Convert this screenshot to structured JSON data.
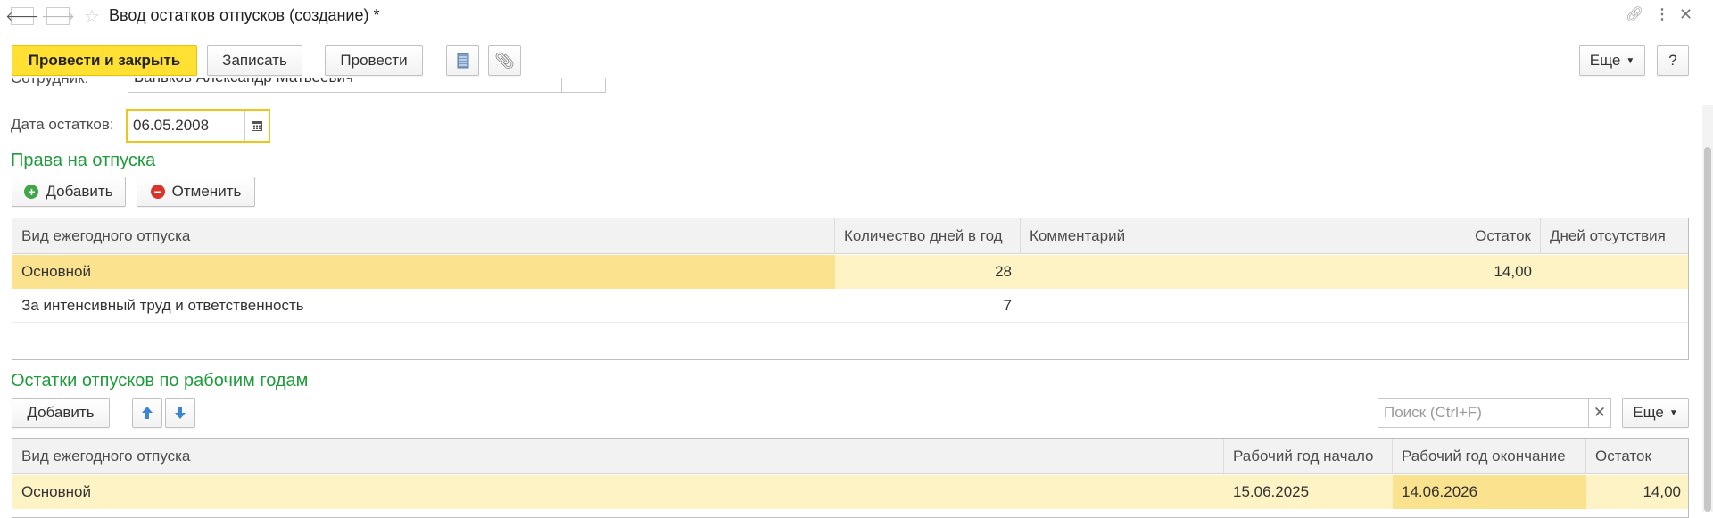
{
  "window": {
    "title": "Ввод остатков отпусков (создание) *",
    "back_icon": "arrow-left-icon",
    "forward_icon": "arrow-right-icon",
    "star_icon": "star-icon",
    "link_icon": "link-icon",
    "more_icon": "vertical-dots-icon",
    "close_icon": "close-icon"
  },
  "toolbar": {
    "post_and_close": "Провести и закрыть",
    "save": "Записать",
    "post": "Провести",
    "more": "Еще",
    "help": "?"
  },
  "form": {
    "employee_label": "Сотрудник:",
    "employee_value": "Баньков Александр Матвеевич",
    "date_label": "Дата остатков:",
    "date_value": "06.05.2008"
  },
  "rights": {
    "title": "Права на отпуска",
    "add": "Добавить",
    "cancel": "Отменить",
    "columns": [
      "Вид ежегодного отпуска",
      "Количество дней в год",
      "Комментарий",
      "Остаток",
      "Дней отсутствия"
    ],
    "rows": [
      {
        "type": "Основной",
        "days": "28",
        "comment": "",
        "remainder": "14,00",
        "absence": ""
      },
      {
        "type": "За интенсивный труд и ответственность",
        "days": "7",
        "comment": "",
        "remainder": "",
        "absence": ""
      }
    ]
  },
  "balances": {
    "title": "Остатки отпусков по рабочим годам",
    "add": "Добавить",
    "search_placeholder": "Поиск (Ctrl+F)",
    "more": "Еще",
    "columns": [
      "Вид ежегодного отпуска",
      "Рабочий год начало",
      "Рабочий год окончание",
      "Остаток"
    ],
    "rows": [
      {
        "type": "Основной",
        "start": "15.06.2025",
        "end": "14.06.2026",
        "remainder": "14,00"
      }
    ]
  },
  "colors": {
    "primary_button": "#ffe033",
    "section_title": "#1e9b3a",
    "selected_row": "#fdf3c4",
    "selected_cell": "#fbe28e",
    "focus_border": "#f0c419"
  }
}
